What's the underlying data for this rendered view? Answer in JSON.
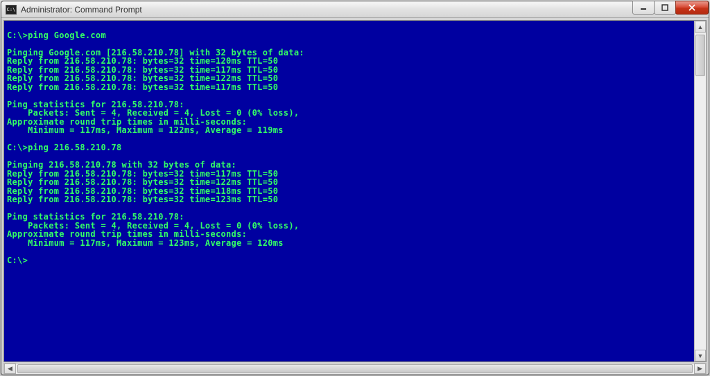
{
  "window": {
    "title": "Administrator: Command Prompt",
    "icon_label": "C:\\"
  },
  "terminal": {
    "lines": [
      "",
      "C:\\>ping Google.com",
      "",
      "Pinging Google.com [216.58.210.78] with 32 bytes of data:",
      "Reply from 216.58.210.78: bytes=32 time=120ms TTL=50",
      "Reply from 216.58.210.78: bytes=32 time=117ms TTL=50",
      "Reply from 216.58.210.78: bytes=32 time=122ms TTL=50",
      "Reply from 216.58.210.78: bytes=32 time=117ms TTL=50",
      "",
      "Ping statistics for 216.58.210.78:",
      "    Packets: Sent = 4, Received = 4, Lost = 0 (0% loss),",
      "Approximate round trip times in milli-seconds:",
      "    Minimum = 117ms, Maximum = 122ms, Average = 119ms",
      "",
      "C:\\>ping 216.58.210.78",
      "",
      "Pinging 216.58.210.78 with 32 bytes of data:",
      "Reply from 216.58.210.78: bytes=32 time=117ms TTL=50",
      "Reply from 216.58.210.78: bytes=32 time=122ms TTL=50",
      "Reply from 216.58.210.78: bytes=32 time=118ms TTL=50",
      "Reply from 216.58.210.78: bytes=32 time=123ms TTL=50",
      "",
      "Ping statistics for 216.58.210.78:",
      "    Packets: Sent = 4, Received = 4, Lost = 0 (0% loss),",
      "Approximate round trip times in milli-seconds:",
      "    Minimum = 117ms, Maximum = 123ms, Average = 120ms",
      "",
      "C:\\>"
    ]
  }
}
